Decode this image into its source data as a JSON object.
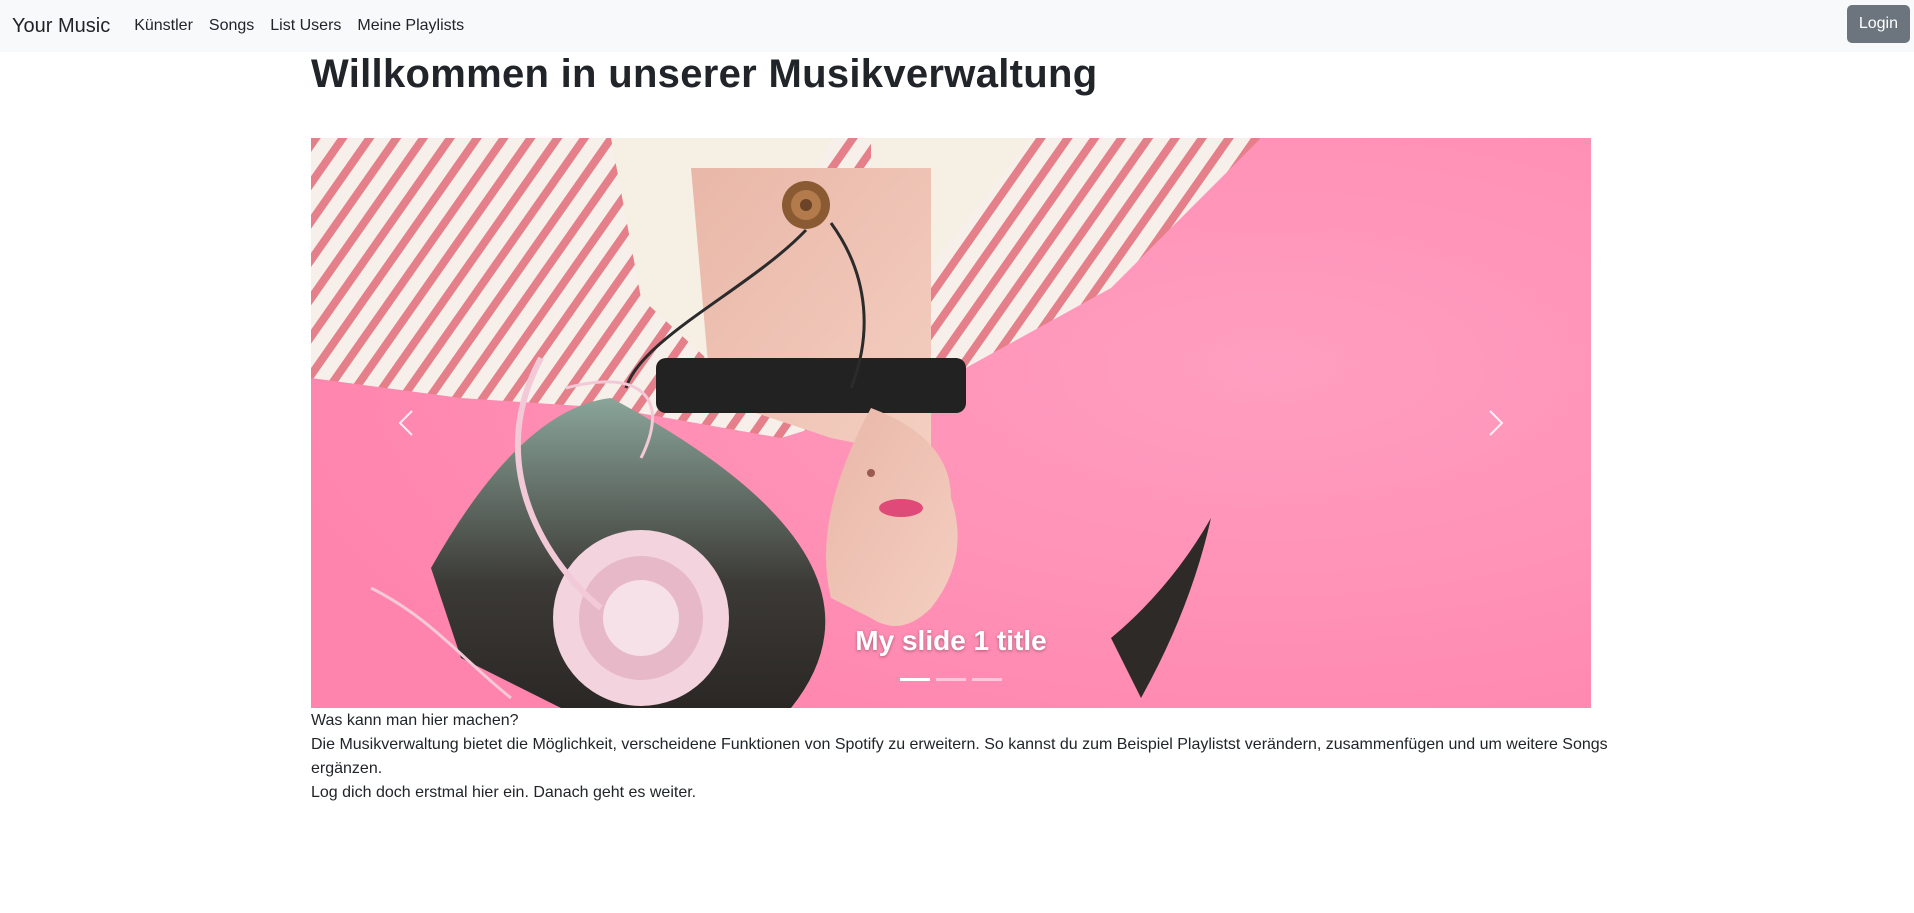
{
  "nav": {
    "brand": "Your Music",
    "links": [
      {
        "label": "Künstler"
      },
      {
        "label": "Songs"
      },
      {
        "label": "List Users"
      },
      {
        "label": "Meine Playlists"
      }
    ],
    "login_label": "Login"
  },
  "page": {
    "title": "Willkommen in unserer Musikverwaltung"
  },
  "carousel": {
    "slide_title": "My slide 1 title",
    "indicator_count": 3,
    "active_index": 0
  },
  "content": {
    "heading": "Was kann man hier machen?",
    "description": "Die Musikverwaltung bietet die Möglichkeit, verscheidene Funktionen von Spotify zu erweitern. So kannst du zum Beispiel Playlistst verändern, zusammenfügen und um weitere Songs ergänzen.",
    "call_to_action": "Log dich doch erstmal hier ein. Danach geht es weiter."
  },
  "colors": {
    "navbar_bg": "#f8f9fa",
    "login_button_bg": "#6c757d",
    "slide_background": "#ff8fb5"
  },
  "icons": [
    "chevron-left-icon",
    "chevron-right-icon"
  ]
}
